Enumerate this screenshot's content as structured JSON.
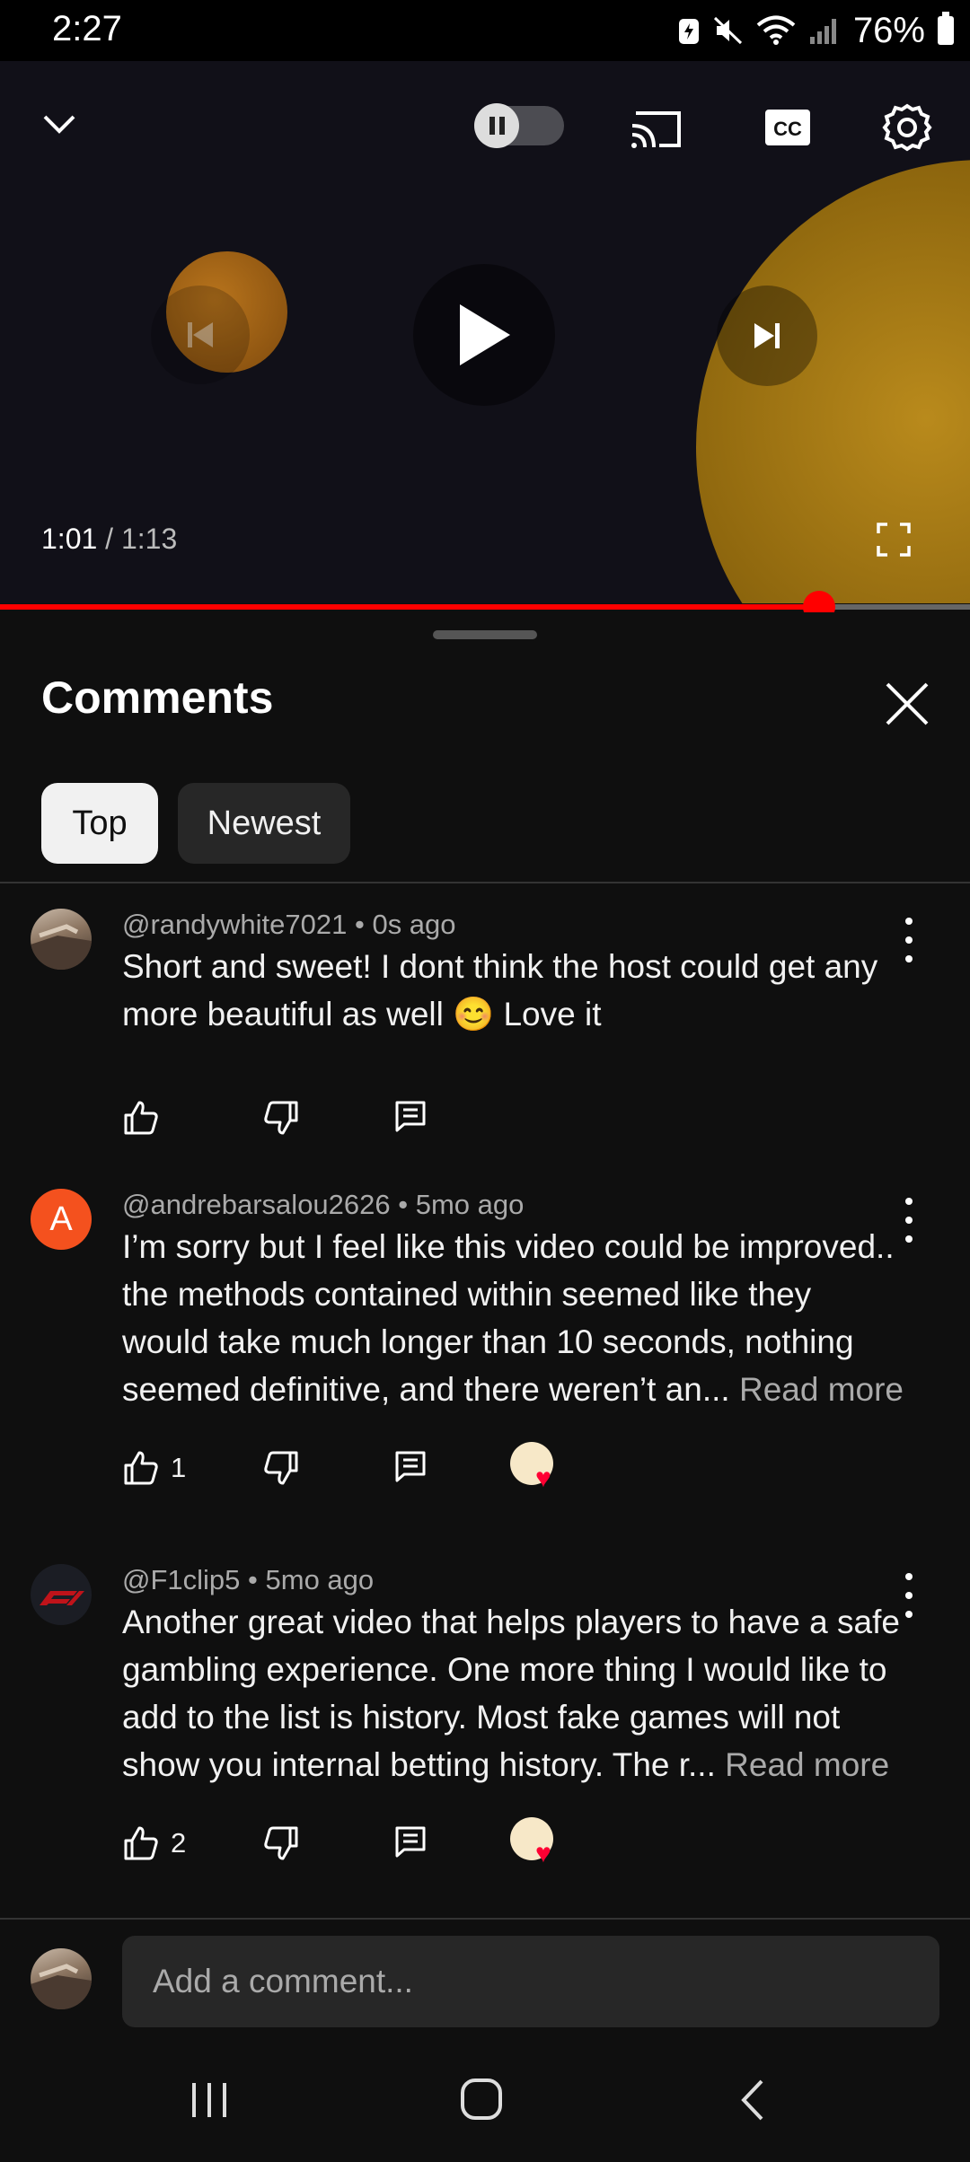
{
  "status_bar": {
    "time": "2:27",
    "battery": "76%"
  },
  "player": {
    "current_time": "1:01",
    "separator": " / ",
    "duration": "1:13",
    "progress_fraction": 0.844,
    "icons": [
      "chevron-down-icon",
      "autoplay-toggle",
      "cast-icon",
      "cc-icon",
      "settings-icon",
      "previous-icon",
      "play-icon",
      "next-icon",
      "fullscreen-icon"
    ]
  },
  "comments": {
    "title": "Comments",
    "filters": [
      "Top",
      "Newest"
    ],
    "selected_filter": "Top",
    "items": [
      {
        "author": "@randywhite7021",
        "age": "0s ago",
        "text": "Short and sweet! I dont think the host could get any more beautiful as well 😊  Love it",
        "read_more": "",
        "likes": "",
        "creator_heart": false,
        "avatar": "photo"
      },
      {
        "author": "@andrebarsalou2626",
        "age": "5mo ago",
        "text": "I’m sorry but I feel like this video could be improved.. the methods contained within seemed like they would take much longer than 10 seconds, nothing seemed definitive, and there weren’t an...",
        "read_more": "Read more",
        "likes": "1",
        "creator_heart": true,
        "avatar": "A"
      },
      {
        "author": "@F1clip5",
        "age": "5mo ago",
        "text": "Another great video that helps players to have a safe gambling experience. One more thing I would like to add to the list is history. Most fake games will not show you internal betting history. The r...",
        "read_more": "Read more",
        "likes": "2",
        "creator_heart": true,
        "avatar": "f1-logo"
      }
    ],
    "add_comment_placeholder": "Add a comment..."
  },
  "colors": {
    "accent": "#ff0000",
    "background": "#0f0f0f",
    "chip_selected": "#f1f1f1",
    "avatar_letter_bg": "#f4511e"
  }
}
